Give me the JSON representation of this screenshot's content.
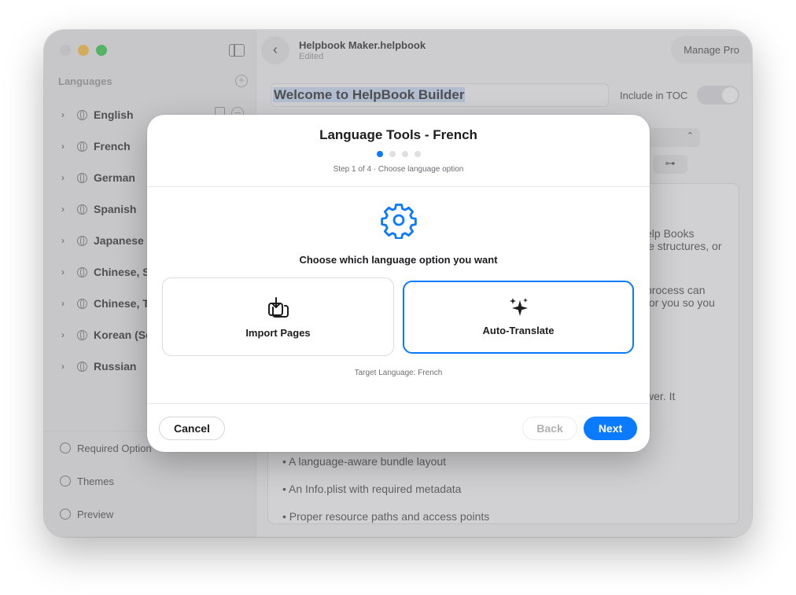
{
  "window": {
    "doc_title": "Helpbook Maker.helpbook",
    "doc_status": "Edited",
    "manage_pro": "Manage Pro"
  },
  "sidebar": {
    "section_title": "Languages",
    "languages": [
      "English",
      "French",
      "German",
      "Spanish",
      "Japanese",
      "Chinese, Si",
      "Chinese, Tr",
      "Korean (Sou",
      "Russian"
    ],
    "bottom_items": [
      {
        "label": "Required Option",
        "icon": "gear-icon"
      },
      {
        "label": "Themes",
        "icon": "palette-icon"
      },
      {
        "label": "Preview",
        "icon": "eye-icon"
      }
    ]
  },
  "editor": {
    "page_title": "Welcome to HelpBook Builder",
    "toc_label": "Include in TOC",
    "tool_glyph": "⊶",
    "fragments": [
      "elp Books",
      "le structures, or",
      "process can",
      "for you so you",
      "wer. It"
    ],
    "bullets": [
      "• A language-aware bundle layout",
      "• An Info.plist with required metadata",
      "• Proper resource paths and access points"
    ]
  },
  "modal": {
    "title": "Language Tools - French",
    "step_text": "Step 1 of 4 · Choose language option",
    "steps_total": 4,
    "current_step": 1,
    "prompt": "Choose which language option you want",
    "options": [
      {
        "label": "Import Pages",
        "icon": "import-tray-icon",
        "selected": false
      },
      {
        "label": "Auto-Translate",
        "icon": "sparkles-icon",
        "selected": true
      }
    ],
    "target_language": "Target Language: French",
    "buttons": {
      "cancel": "Cancel",
      "back": "Back",
      "next": "Next"
    },
    "accent_color": "#0a7aff"
  }
}
